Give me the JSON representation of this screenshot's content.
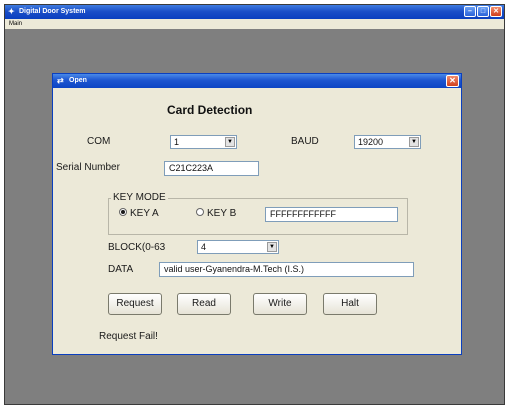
{
  "main_window": {
    "title": "Digital Door System",
    "menu": [
      "Main"
    ]
  },
  "dialog": {
    "title": "Open",
    "heading": "Card Detection",
    "com": {
      "label": "COM",
      "value": "1"
    },
    "baud": {
      "label": "BAUD",
      "value": "19200"
    },
    "serial": {
      "label": "Serial Number",
      "value": "C21C223A"
    },
    "key_mode": {
      "label": "KEY MODE",
      "options": [
        {
          "label": "KEY A",
          "selected": true
        },
        {
          "label": "KEY B",
          "selected": false
        }
      ],
      "key_value": "FFFFFFFFFFFF"
    },
    "block": {
      "label": "BLOCK(0-63",
      "value": "4"
    },
    "data_field": {
      "label": "DATA",
      "value": "valid user-Gyanendra-M.Tech (I.S.)"
    },
    "buttons": {
      "request": "Request",
      "read": "Read",
      "write": "Write",
      "halt": "Halt"
    },
    "status": "Request Fail!"
  },
  "icons": {
    "app": "app-icon",
    "dialog": "dialog-icon",
    "minimize": "minimize-icon",
    "maximize": "maximize-icon",
    "close": "close-icon",
    "dropdown": "chevron-down-icon"
  },
  "colors": {
    "titlebar": "#1b4fc8",
    "dialog_bg": "#ece9d8",
    "desktop_bg": "#7f7f7f",
    "close_button": "#d0401e"
  }
}
